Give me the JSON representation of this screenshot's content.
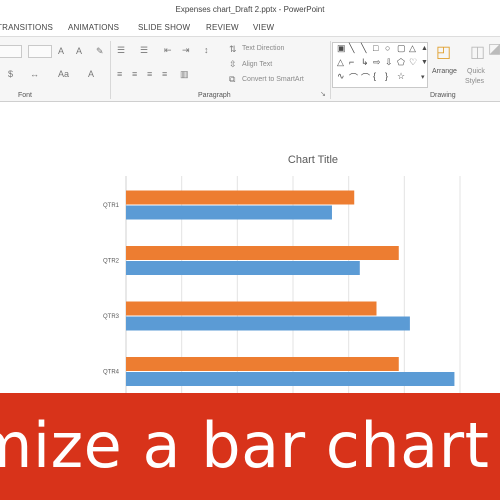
{
  "window": {
    "title": "Expenses chart_Draft 2.pptx - PowerPoint"
  },
  "tabs": [
    "TRANSITIONS",
    "ANIMATIONS",
    "SLIDE SHOW",
    "REVIEW",
    "VIEW"
  ],
  "ribbon": {
    "groups": {
      "font": "Font",
      "paragraph": "Paragraph",
      "drawing": "Drawing"
    },
    "paragraph_commands": {
      "text_direction": "Text Direction",
      "align_text": "Align Text",
      "convert_smartart": "Convert to SmartArt"
    },
    "drawing_commands": {
      "arrange": "Arrange",
      "quick_styles_line1": "Quick",
      "quick_styles_line2": "Styles"
    }
  },
  "chart_data": {
    "type": "bar",
    "title": "Chart Title",
    "categories": [
      "QTR1",
      "QTR2",
      "QTR3",
      "QTR4"
    ],
    "series": [
      {
        "color": "#5b9bd5",
        "values": [
          37,
          42,
          51,
          59
        ]
      },
      {
        "color": "#ed7d31",
        "values": [
          41,
          49,
          45,
          49
        ]
      }
    ],
    "xlim": [
      0,
      60
    ],
    "grid": true,
    "legend": "none"
  },
  "banner": {
    "text": "mize a bar chart",
    "color": "#d8331a"
  }
}
